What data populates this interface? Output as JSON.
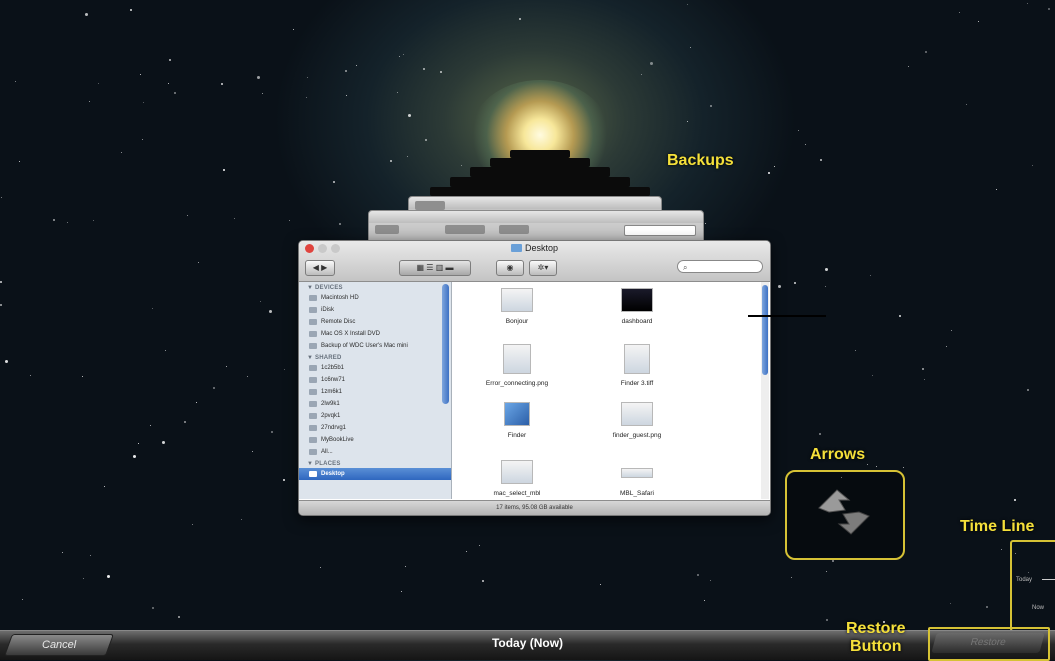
{
  "annotations": {
    "backups": "Backups",
    "arrows": "Arrows",
    "time_line": "Time Line",
    "restore_button": "Restore\nButton"
  },
  "finder": {
    "title": "Desktop",
    "search_placeholder": "",
    "status": "17 items, 95.08 GB available",
    "sidebar": {
      "devices_header": "▼ DEVICES",
      "devices": [
        "Macintosh HD",
        "iDisk",
        "Remote Disc",
        "Mac OS X Install DVD",
        "Backup of WDC User's Mac mini"
      ],
      "shared_header": "▼ SHARED",
      "shared": [
        "1c2b5b1",
        "1c6nw71",
        "1zm6k1",
        "2lw9k1",
        "2pvqk1",
        "27ndrvg1",
        "MyBookLive",
        "All..."
      ],
      "places_header": "▼ PLACES",
      "places_selected": "Desktop"
    },
    "files": [
      "Bonjour",
      "dashboard",
      "Error_connecting.png",
      "Finder 3.tiff",
      "Finder",
      "finder_guest.png",
      "mac_select_mbl",
      "MBL_Safari"
    ]
  },
  "timeline": {
    "today_label": "Today",
    "now_label": "Now"
  },
  "bottom_bar": {
    "cancel_label": "Cancel",
    "date_label": "Today (Now)",
    "restore_label": "Restore"
  }
}
